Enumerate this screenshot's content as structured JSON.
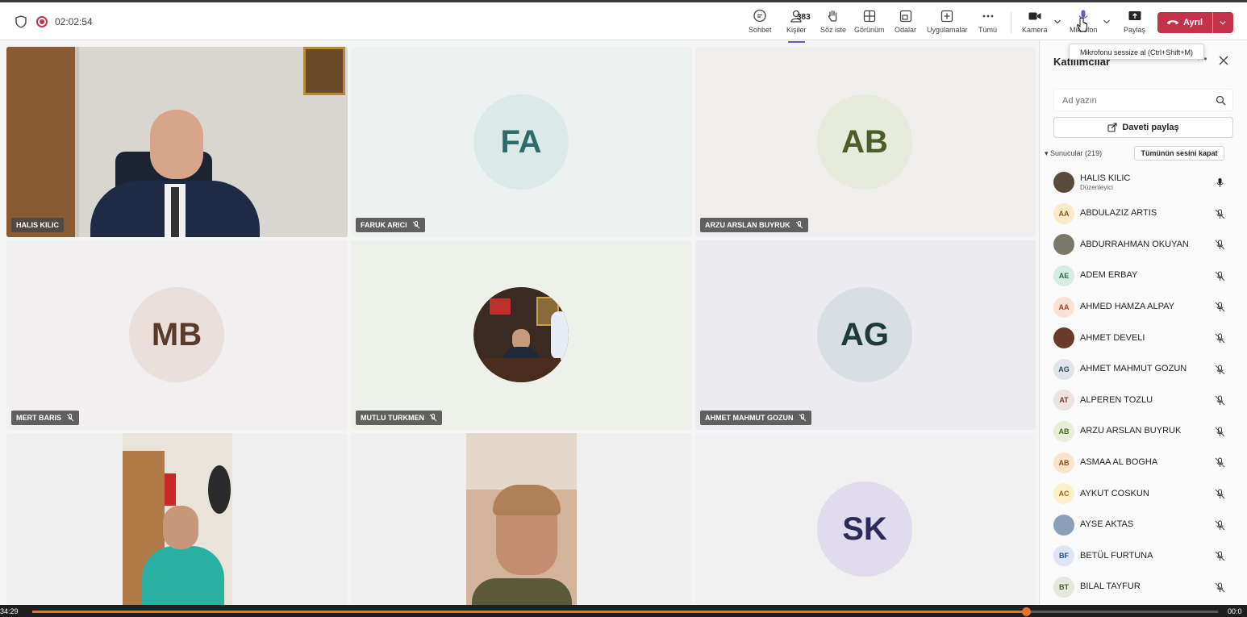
{
  "header": {
    "timer": "02:02:54",
    "people_count": "383",
    "buttons": {
      "chat": "Sohbet",
      "people": "Kişiler",
      "raise": "Söz iste",
      "view": "Görünüm",
      "rooms": "Odalar",
      "apps": "Uygulamalar",
      "more": "Tümü",
      "camera": "Kamera",
      "mic": "Mikrofon",
      "share": "Paylaş",
      "leave": "Ayrıl"
    },
    "tooltip": "Mikrofonu sessize al (Ctrl+Shift+M)"
  },
  "tiles": [
    {
      "name": "HALIS KILIC",
      "initials": "",
      "muted": false
    },
    {
      "name": "FARUK ARICI",
      "initials": "FA",
      "muted": true
    },
    {
      "name": "ARZU ARSLAN BUYRUK",
      "initials": "AB",
      "muted": true
    },
    {
      "name": "MERT BARIS",
      "initials": "MB",
      "muted": true
    },
    {
      "name": "MUTLU TURKMEN",
      "initials": "",
      "muted": true
    },
    {
      "name": "AHMET MAHMUT GOZUN",
      "initials": "AG",
      "muted": true
    },
    {
      "name": "",
      "initials": "",
      "muted": true
    },
    {
      "name": "",
      "initials": "",
      "muted": true
    },
    {
      "name": "",
      "initials": "SK",
      "muted": true
    }
  ],
  "panel": {
    "title": "Katılımcılar",
    "search_placeholder": "Ad yazın",
    "invite_label": "Daveti paylaş",
    "section_label": "Sunucular (219)",
    "mute_all_label": "Tümünün sesini kapat",
    "participants": [
      {
        "name": "HALIS KILIC",
        "role": "Düzenleyici",
        "initials": "",
        "photo": true,
        "mic": "on"
      },
      {
        "name": "ABDULAZIZ ARTIS",
        "initials": "AA",
        "mic": "off"
      },
      {
        "name": "ABDURRAHMAN OKUYAN",
        "initials": "",
        "photo": true,
        "mic": "off"
      },
      {
        "name": "ADEM ERBAY",
        "initials": "AE",
        "mic": "off"
      },
      {
        "name": "AHMED HAMZA ALPAY",
        "initials": "AA",
        "mic": "off"
      },
      {
        "name": "AHMET DEVELI",
        "initials": "",
        "photo": true,
        "mic": "off"
      },
      {
        "name": "AHMET MAHMUT GOZUN",
        "initials": "AG",
        "mic": "off"
      },
      {
        "name": "ALPEREN TOZLU",
        "initials": "AT",
        "mic": "off"
      },
      {
        "name": "ARZU ARSLAN BUYRUK",
        "initials": "AB",
        "mic": "off"
      },
      {
        "name": "ASMAA AL BOGHA",
        "initials": "AB",
        "mic": "off"
      },
      {
        "name": "AYKUT COSKUN",
        "initials": "AC",
        "mic": "off"
      },
      {
        "name": "AYSE AKTAS",
        "initials": "",
        "photo": true,
        "mic": "off"
      },
      {
        "name": "BETÜL FURTUNA",
        "initials": "BF",
        "mic": "off"
      },
      {
        "name": "BILAL TAYFUR",
        "initials": "BT",
        "mic": "off"
      }
    ]
  },
  "playback": {
    "elapsed": "34:29",
    "remaining": "00:0",
    "progress_fraction": 0.838
  },
  "colors": {
    "accent": "#5b5fc7",
    "leave": "#c4314b",
    "progress": "#e8732a"
  }
}
